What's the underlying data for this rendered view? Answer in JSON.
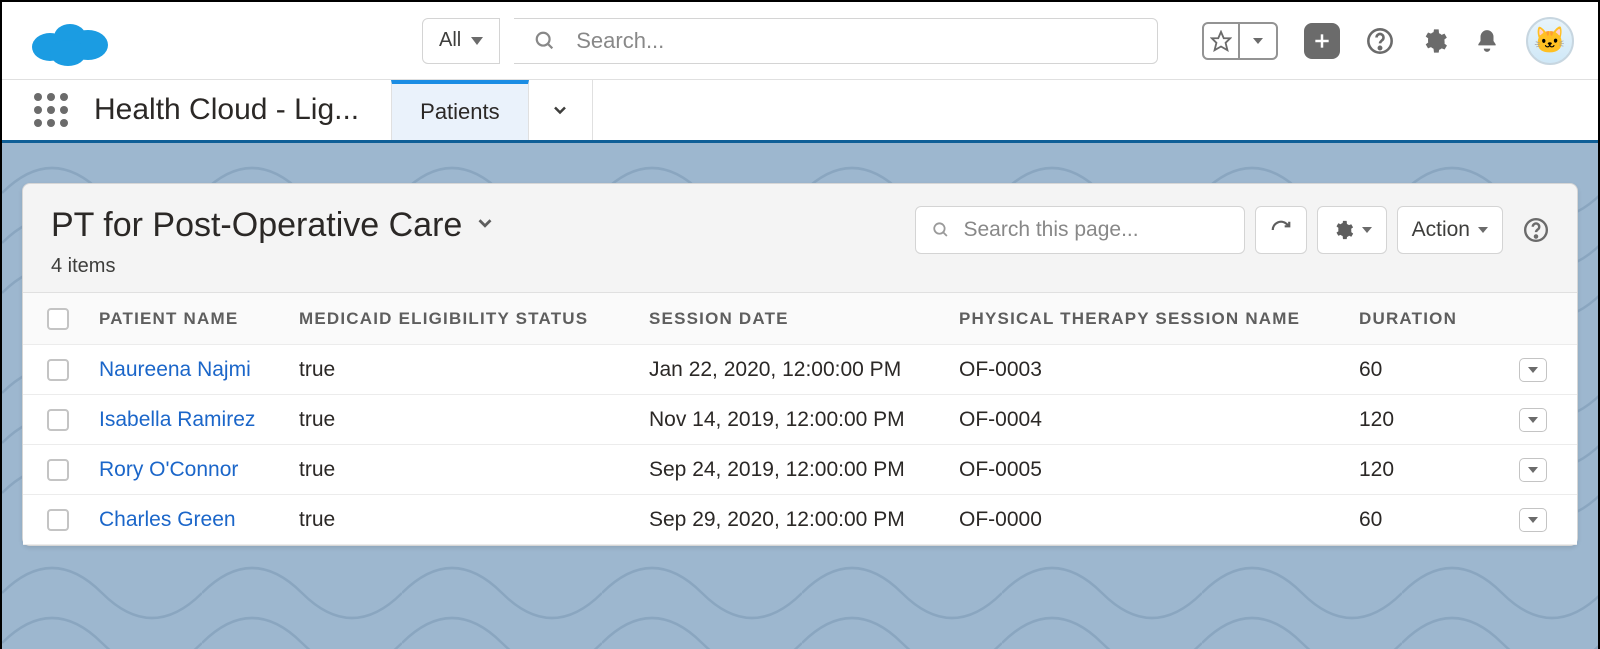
{
  "header": {
    "scope_label": "All",
    "search_placeholder": "Search..."
  },
  "nav": {
    "app_name": "Health Cloud - Lig...",
    "tab_label": "Patients"
  },
  "list": {
    "title": "PT for Post-Operative Care",
    "item_count_label": "4 items",
    "page_search_placeholder": "Search this page...",
    "action_label": "Action"
  },
  "columns": {
    "patient_name": "Patient Name",
    "medicaid": "Medicaid Eligibility Status",
    "session_date": "Session Date",
    "pt_session_name": "Physical Therapy Session Name",
    "duration": "Duration"
  },
  "rows": [
    {
      "patient_name": "Naureena Najmi",
      "medicaid": "true",
      "session_date": "Jan 22, 2020, 12:00:00 PM",
      "pt_session_name": "OF-0003",
      "duration": "60"
    },
    {
      "patient_name": "Isabella Ramirez",
      "medicaid": "true",
      "session_date": "Nov 14, 2019, 12:00:00 PM",
      "pt_session_name": "OF-0004",
      "duration": "120"
    },
    {
      "patient_name": "Rory O'Connor",
      "medicaid": "true",
      "session_date": "Sep 24, 2019, 12:00:00 PM",
      "pt_session_name": "OF-0005",
      "duration": "120"
    },
    {
      "patient_name": "Charles Green",
      "medicaid": "true",
      "session_date": "Sep 29, 2020, 12:00:00 PM",
      "pt_session_name": "OF-0000",
      "duration": "60"
    }
  ]
}
